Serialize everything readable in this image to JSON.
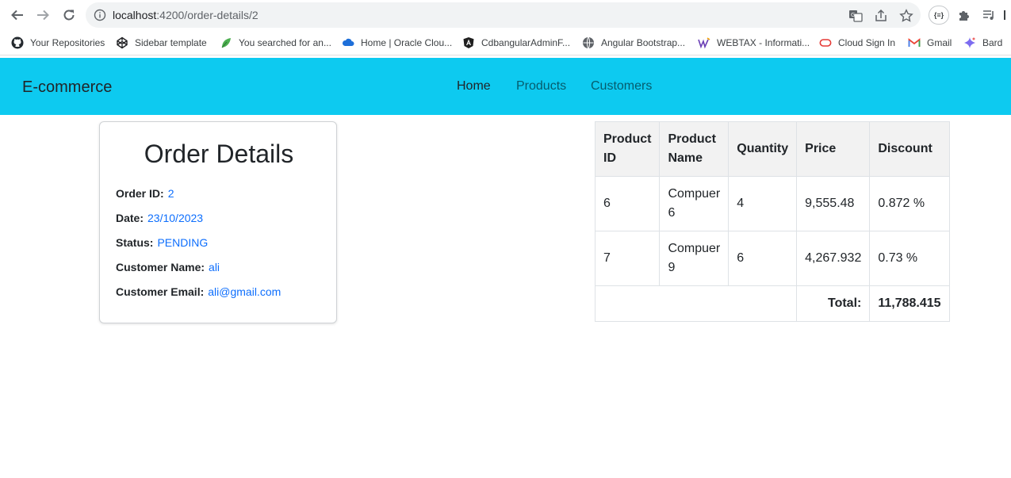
{
  "browser": {
    "url_host": "localhost",
    "url_path": ":4200/order-details/2",
    "extension_badge": "{≡}"
  },
  "bookmarks": [
    {
      "label": "Your Repositories",
      "icon": "github-icon"
    },
    {
      "label": "Sidebar template",
      "icon": "codepen-icon"
    },
    {
      "label": "You searched for an...",
      "icon": "leaf-icon"
    },
    {
      "label": "Home | Oracle Clou...",
      "icon": "cloud-icon"
    },
    {
      "label": "CdbangularAdminF...",
      "icon": "angular-icon"
    },
    {
      "label": "Angular Bootstrap...",
      "icon": "globe-icon"
    },
    {
      "label": "WEBTAX - Informati...",
      "icon": "webtax-icon"
    },
    {
      "label": "Cloud Sign In",
      "icon": "oracle-icon"
    },
    {
      "label": "Gmail",
      "icon": "gmail-icon"
    },
    {
      "label": "Bard",
      "icon": "bard-icon"
    }
  ],
  "navbar": {
    "brand": "E-commerce",
    "links": [
      "Home",
      "Products",
      "Customers"
    ]
  },
  "order": {
    "title": "Order Details",
    "fields": [
      {
        "label": "Order ID:",
        "value": "2"
      },
      {
        "label": "Date:",
        "value": "23/10/2023"
      },
      {
        "label": "Status:",
        "value": "PENDING"
      },
      {
        "label": "Customer Name:",
        "value": "ali"
      },
      {
        "label": "Customer Email:",
        "value": "ali@gmail.com"
      }
    ]
  },
  "table": {
    "headers": [
      "Product ID",
      "Product Name",
      "Quantity",
      "Price",
      "Discount"
    ],
    "rows": [
      [
        "6",
        "Compuer 6",
        "4",
        "9,555.48",
        "0.872 %"
      ],
      [
        "7",
        "Compuer 9",
        "6",
        "4,267.932",
        "0.73 %"
      ]
    ],
    "total_label": "Total:",
    "total_value": "11,788.415"
  },
  "colors": {
    "navbar_bg": "#0dcaf0",
    "link_blue": "#0d6efd"
  }
}
